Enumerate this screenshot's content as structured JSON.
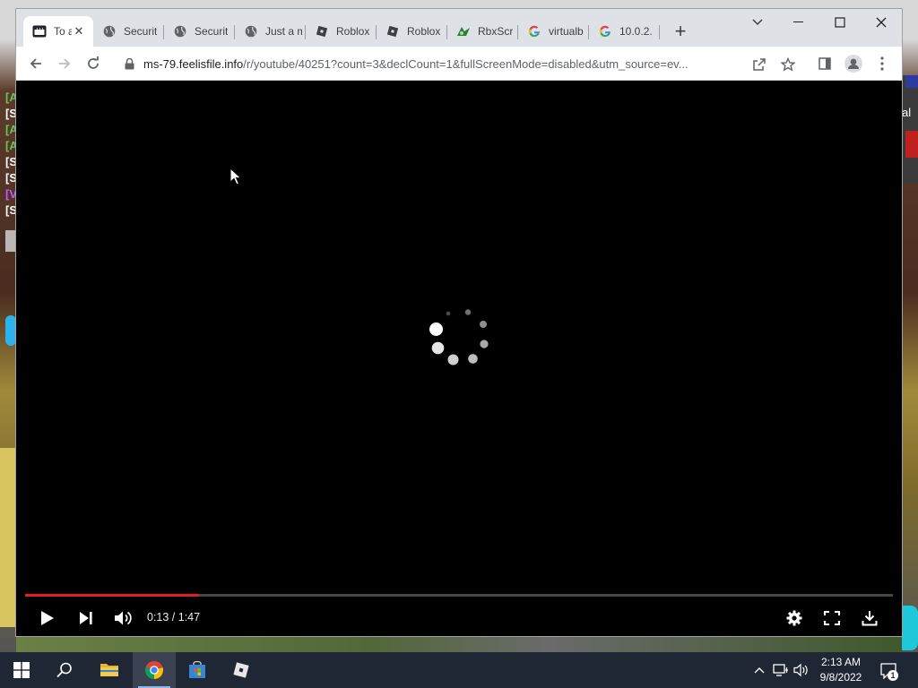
{
  "background": {
    "chat_lines": [
      {
        "text": "[A",
        "color": "green"
      },
      {
        "text": "[S",
        "color": "white"
      },
      {
        "text": "[A",
        "color": "green"
      },
      {
        "text": "[A",
        "color": "green"
      },
      {
        "text": "[S",
        "color": "white"
      },
      {
        "text": "[S",
        "color": "white"
      },
      {
        "text": "[V",
        "color": "purple"
      },
      {
        "text": "[S",
        "color": "white"
      }
    ],
    "right_label": "al"
  },
  "browser": {
    "tabs": [
      {
        "label": "To a",
        "icon": "video-icon",
        "active": true
      },
      {
        "label": "Securit",
        "icon": "globe-icon",
        "active": false
      },
      {
        "label": "Securit",
        "icon": "globe-icon",
        "active": false
      },
      {
        "label": "Just a m",
        "icon": "globe-icon",
        "active": false
      },
      {
        "label": "Roblox",
        "icon": "roblox-icon",
        "active": false
      },
      {
        "label": "Roblox",
        "icon": "roblox-icon",
        "active": false
      },
      {
        "label": "RbxScr",
        "icon": "rbxscripts-icon",
        "active": false
      },
      {
        "label": "virtualb",
        "icon": "google-icon",
        "active": false
      },
      {
        "label": "10.0.2.",
        "icon": "google-icon",
        "active": false
      }
    ],
    "url_host": "ms-79.feelisfile.info",
    "url_path": "/r/youtube/40251?count=3&declCount=1&fullScreenMode=disabled&utm_source=ev...",
    "colors": {
      "tabstrip": "#dee1e6",
      "toolbar": "#ffffff"
    }
  },
  "player": {
    "current_time": "0:13",
    "duration": "1:47",
    "time_display": "0:13 / 1:47",
    "progress": 0.2,
    "progress_color": "#e0201e",
    "state": "loading"
  },
  "taskbar": {
    "apps": [
      "start-icon",
      "search-icon",
      "file-explorer-icon",
      "chrome-icon",
      "store-icon",
      "roblox-icon"
    ],
    "time": "2:13 AM",
    "date": "9/8/2022",
    "notification_count": "1"
  }
}
